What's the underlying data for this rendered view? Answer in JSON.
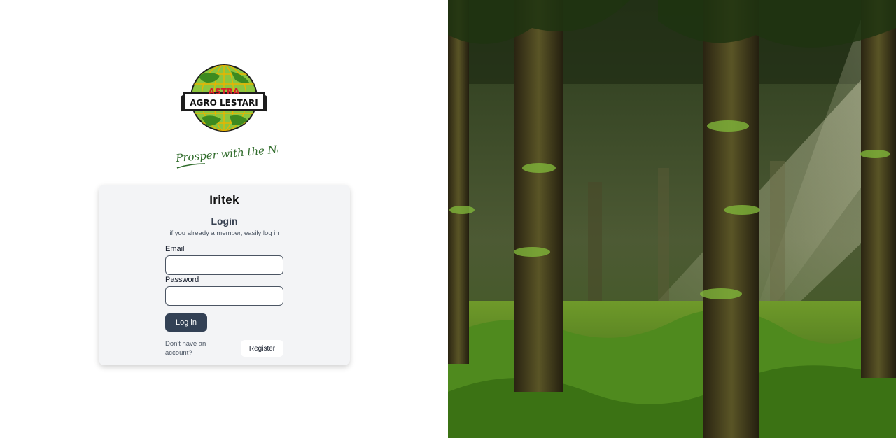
{
  "brand": {
    "logo_top_text": "ASTRA",
    "logo_main_text": "AGRO LESTARI",
    "tagline": "Prosper with the Nation"
  },
  "login_card": {
    "app_title": "Iritek",
    "heading": "Login",
    "subtitle": "if you already a member, easily log in",
    "email_label": "Email",
    "email_value": "",
    "password_label": "Password",
    "password_value": "",
    "login_button": "Log in",
    "no_account_text": "Don't have an account?",
    "register_button": "Register"
  },
  "colors": {
    "card_bg": "#f3f4f6",
    "primary_button": "#334155",
    "logo_green": "#5cab32",
    "logo_red": "#d6202a",
    "tagline_green": "#2f6b2a"
  }
}
